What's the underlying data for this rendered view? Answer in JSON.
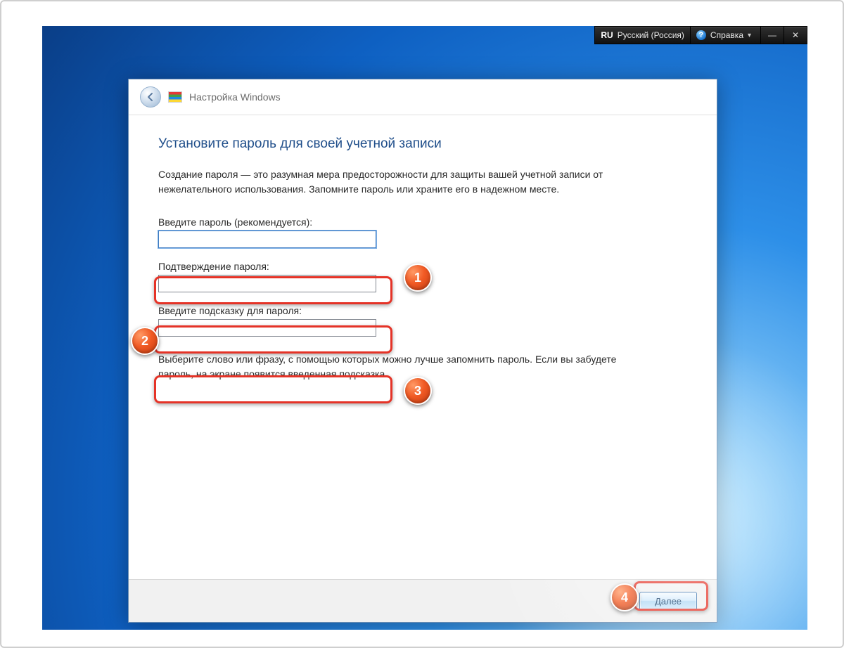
{
  "topbar": {
    "lang_code": "RU",
    "lang_name": "Русский (Россия)",
    "help_label": "Справка"
  },
  "window": {
    "title": "Настройка Windows",
    "heading": "Установите пароль для своей учетной записи",
    "description": "Создание пароля — это разумная мера предосторожности для защиты вашей учетной записи от нежелательного использования. Запомните пароль или храните его в надежном месте.",
    "fields": {
      "password_label": "Введите пароль (рекомендуется):",
      "password_value": "",
      "confirm_label": "Подтверждение пароля:",
      "confirm_value": "",
      "hint_label": "Введите подсказку для пароля:",
      "hint_value": ""
    },
    "hint_text": "Выберите слово или фразу, с помощью которых можно лучше запомнить пароль. Если вы забудете пароль, на экране появится введенная подсказка.",
    "next_button": "Далее"
  },
  "annotations": {
    "badge1": "1",
    "badge2": "2",
    "badge3": "3",
    "badge4": "4"
  },
  "colors": {
    "annotation_red": "#e53327",
    "badge_orange": "#f15a24",
    "heading_blue": "#1f4e8a"
  }
}
